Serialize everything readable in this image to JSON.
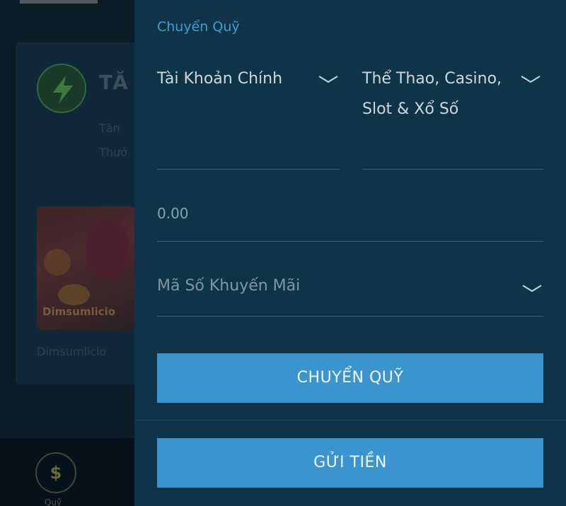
{
  "background": {
    "card_title": "TĂ",
    "card_line1": "Tăn",
    "card_line2": "Thưở",
    "game_logo": "Dimsumlicio",
    "game_name": "Dimsumlicio",
    "bottom_nav_icon_symbol": "$",
    "bottom_nav_label": "Quỹ"
  },
  "transfer": {
    "section_title": "Chuyển Quỹ",
    "from_account": "Tài Khoản Chính",
    "to_account": "Thể Thao, Casino, Slot & Xổ Số",
    "amount_placeholder": "0.00",
    "promo_placeholder": "Mã Số Khuyến Mãi",
    "transfer_button": "CHUYỂN QUỸ",
    "deposit_button": "GỬI TIỀN"
  },
  "colors": {
    "accent": "#3a95cf",
    "panel_bg": "#0f3447",
    "title_blue": "#3c9ed3"
  },
  "icons": {
    "bolt": "lightning-bolt-icon",
    "chevron": "chevron-down-icon",
    "dollar": "dollar-coin-icon"
  }
}
